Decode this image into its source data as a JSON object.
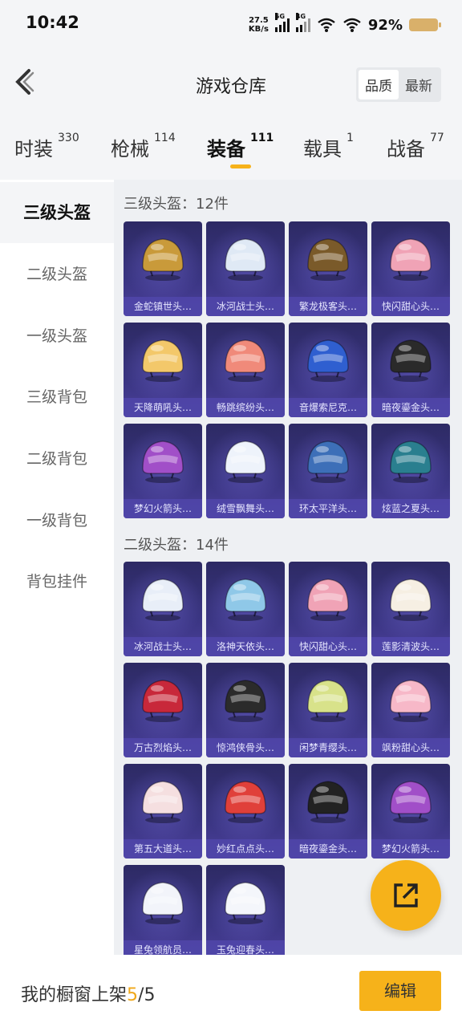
{
  "status_bar": {
    "time": "10:42",
    "net_speed_value": "27.5",
    "net_speed_unit": "KB/s",
    "signal1_label": "5G",
    "signal2_label": "4G",
    "battery": "92%"
  },
  "header": {
    "title": "游戏仓库",
    "sort_quality": "品质",
    "sort_latest": "最新"
  },
  "tabs": [
    {
      "label": "时装",
      "count": "330"
    },
    {
      "label": "枪械",
      "count": "114"
    },
    {
      "label": "装备",
      "count": "111"
    },
    {
      "label": "载具",
      "count": "1"
    },
    {
      "label": "战备",
      "count": "77"
    }
  ],
  "sidebar": {
    "items": [
      "三级头盔",
      "二级头盔",
      "一级头盔",
      "三级背包",
      "二级背包",
      "一级背包",
      "背包挂件"
    ]
  },
  "sections": [
    {
      "title": "三级头盔：12件",
      "items": [
        {
          "label": "金蛇镇世头…",
          "color": "#c99a3a"
        },
        {
          "label": "冰河战士头…",
          "color": "#dfe9f5"
        },
        {
          "label": "繁龙极客头…",
          "color": "#7a5a2a"
        },
        {
          "label": "快闪甜心头…",
          "color": "#f0a3b6"
        },
        {
          "label": "天降萌吼头…",
          "color": "#f3c86a"
        },
        {
          "label": "畅跳缤纷头…",
          "color": "#f08a7a"
        },
        {
          "label": "音爆索尼克…",
          "color": "#2f5fd0"
        },
        {
          "label": "暗夜鎏金头…",
          "color": "#2a2a2a"
        },
        {
          "label": "梦幻火箭头…",
          "color": "#a14fc8"
        },
        {
          "label": "绒雪飘舞头…",
          "color": "#eef3fb"
        },
        {
          "label": "环太平洋头…",
          "color": "#3d6fb8"
        },
        {
          "label": "炫蓝之夏头…",
          "color": "#2a7f8f"
        }
      ]
    },
    {
      "title": "二级头盔：14件",
      "items": [
        {
          "label": "冰河战士头…",
          "color": "#e8eef8"
        },
        {
          "label": "洛神天依头…",
          "color": "#8fc8e8"
        },
        {
          "label": "快闪甜心头…",
          "color": "#f0a3b6"
        },
        {
          "label": "莲影清波头…",
          "color": "#f6efe3"
        },
        {
          "label": "万古烈焰头…",
          "color": "#c8283a"
        },
        {
          "label": "惊鸿侠骨头…",
          "color": "#2b2b2b"
        },
        {
          "label": "闲梦青缨头…",
          "color": "#d8e28a"
        },
        {
          "label": "飒粉甜心头…",
          "color": "#f7b8c8"
        },
        {
          "label": "第五大道头…",
          "color": "#f5dfe0"
        },
        {
          "label": "妙红点点头…",
          "color": "#e0403a"
        },
        {
          "label": "暗夜鎏金头…",
          "color": "#222222"
        },
        {
          "label": "梦幻火箭头…",
          "color": "#a14fc8"
        },
        {
          "label": "星兔领航员…",
          "color": "#f2f4fa"
        },
        {
          "label": "玉兔迎春头…",
          "color": "#f4f6fb"
        }
      ]
    }
  ],
  "bottom": {
    "showcase_prefix": "我的橱窗上架",
    "showcase_current": "5",
    "showcase_sep": "/",
    "showcase_total": "5",
    "edit_label": "编辑"
  }
}
